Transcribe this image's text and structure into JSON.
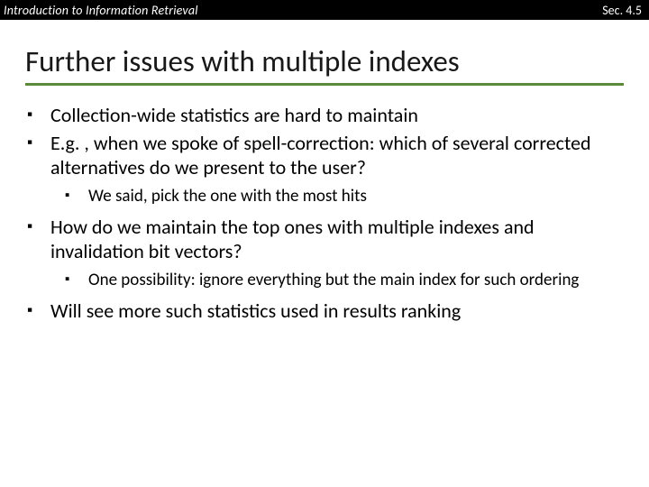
{
  "header": {
    "course": "Introduction to Information Retrieval",
    "section": "Sec. 4.5"
  },
  "title": "Further issues with multiple indexes",
  "bullets": [
    {
      "level": 1,
      "text": "Collection-wide statistics are hard to maintain"
    },
    {
      "level": 1,
      "text": "E.g. , when we spoke of spell-correction: which of several corrected alternatives do we present to the user?"
    },
    {
      "level": 2,
      "text": "We said, pick the one with the most hits"
    },
    {
      "level": 1,
      "text": "How do we maintain the top ones with multiple indexes and invalidation bit vectors?"
    },
    {
      "level": 2,
      "text": "One possibility: ignore everything but the main index for such ordering"
    },
    {
      "level": 1,
      "text": "Will see more such statistics used in results ranking"
    }
  ]
}
